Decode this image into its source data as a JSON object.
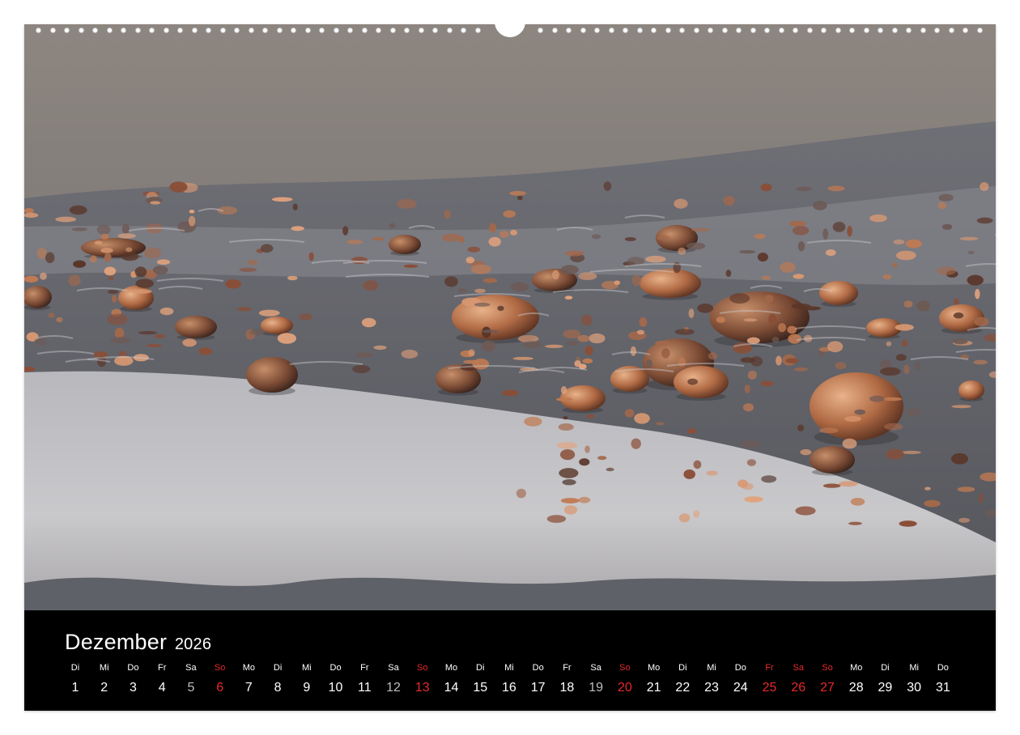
{
  "calendar": {
    "month": "Dezember",
    "year": "2026",
    "days": [
      {
        "wd": "Di",
        "d": "1",
        "kind": "normal"
      },
      {
        "wd": "Mi",
        "d": "2",
        "kind": "normal"
      },
      {
        "wd": "Do",
        "d": "3",
        "kind": "normal"
      },
      {
        "wd": "Fr",
        "d": "4",
        "kind": "normal"
      },
      {
        "wd": "Sa",
        "d": "5",
        "kind": "sat"
      },
      {
        "wd": "So",
        "d": "6",
        "kind": "sun"
      },
      {
        "wd": "Mo",
        "d": "7",
        "kind": "normal"
      },
      {
        "wd": "Di",
        "d": "8",
        "kind": "normal"
      },
      {
        "wd": "Mi",
        "d": "9",
        "kind": "normal"
      },
      {
        "wd": "Do",
        "d": "10",
        "kind": "normal"
      },
      {
        "wd": "Fr",
        "d": "11",
        "kind": "normal"
      },
      {
        "wd": "Sa",
        "d": "12",
        "kind": "sat"
      },
      {
        "wd": "So",
        "d": "13",
        "kind": "sun"
      },
      {
        "wd": "Mo",
        "d": "14",
        "kind": "normal"
      },
      {
        "wd": "Di",
        "d": "15",
        "kind": "normal"
      },
      {
        "wd": "Mi",
        "d": "16",
        "kind": "normal"
      },
      {
        "wd": "Do",
        "d": "17",
        "kind": "normal"
      },
      {
        "wd": "Fr",
        "d": "18",
        "kind": "normal"
      },
      {
        "wd": "Sa",
        "d": "19",
        "kind": "sat"
      },
      {
        "wd": "So",
        "d": "20",
        "kind": "sun"
      },
      {
        "wd": "Mo",
        "d": "21",
        "kind": "normal"
      },
      {
        "wd": "Di",
        "d": "22",
        "kind": "normal"
      },
      {
        "wd": "Mi",
        "d": "23",
        "kind": "normal"
      },
      {
        "wd": "Do",
        "d": "24",
        "kind": "normal"
      },
      {
        "wd": "Fr",
        "d": "25",
        "kind": "hol"
      },
      {
        "wd": "Sa",
        "d": "26",
        "kind": "hol"
      },
      {
        "wd": "So",
        "d": "27",
        "kind": "sun"
      },
      {
        "wd": "Mo",
        "d": "28",
        "kind": "normal"
      },
      {
        "wd": "Di",
        "d": "29",
        "kind": "normal"
      },
      {
        "wd": "Mi",
        "d": "30",
        "kind": "normal"
      },
      {
        "wd": "Do",
        "d": "31",
        "kind": "normal"
      }
    ]
  },
  "colors": {
    "weekend_red": "#e8292c",
    "saturday_grey": "#bdbdbd",
    "background": "#000000"
  },
  "icons": {
    "binding": "spiral-binding-holes-icon",
    "hanger": "hanger-notch-icon"
  }
}
